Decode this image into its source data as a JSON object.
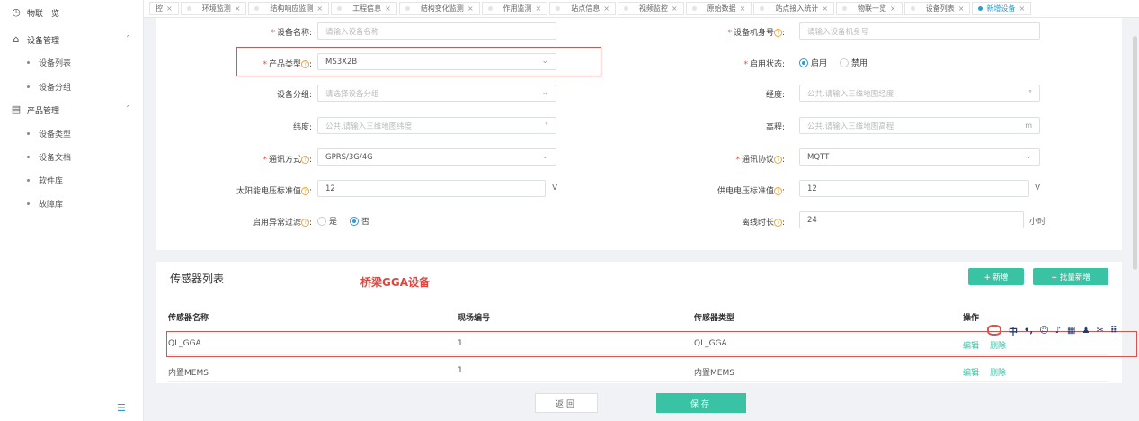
{
  "sidebar": {
    "top_item": "物联一览",
    "groups": [
      {
        "label": "设备管理",
        "items": [
          "设备列表",
          "设备分组"
        ]
      },
      {
        "label": "产品管理",
        "items": [
          "设备类型",
          "设备文档",
          "软件库",
          "故障库"
        ]
      }
    ]
  },
  "tabs": [
    "控",
    "环境监测",
    "结构响应监测",
    "工程信息",
    "结构变化监测",
    "作用监测",
    "站点信息",
    "视频监控",
    "原始数据",
    "站点接入统计",
    "物联一览",
    "设备列表",
    "新增设备"
  ],
  "form": {
    "device_name": {
      "label": "设备名称",
      "placeholder": "请输入设备名称"
    },
    "device_serial": {
      "label": "设备机身号",
      "placeholder": "请输入设备机身号"
    },
    "product_type": {
      "label": "产品类型",
      "value": "MS3X2B"
    },
    "enable_status": {
      "label": "启用状态",
      "options": [
        "启用",
        "禁用"
      ]
    },
    "device_group": {
      "label": "设备分组",
      "placeholder": "请选择设备分组"
    },
    "longitude": {
      "label": "经度",
      "placeholder": "公共.请输入三维地图经度",
      "suffix": "°"
    },
    "latitude": {
      "label": "纬度",
      "placeholder": "公共.请输入三维地图纬度",
      "suffix": "°"
    },
    "elevation": {
      "label": "高程",
      "placeholder": "公共.请输入三维地图高程",
      "suffix": "m"
    },
    "comm_mode": {
      "label": "通讯方式",
      "value": "GPRS/3G/4G"
    },
    "comm_protocol": {
      "label": "通讯协议",
      "value": "MQTT"
    },
    "solar_voltage": {
      "label": "太阳能电压标准值",
      "value": "12",
      "unit": "V"
    },
    "supply_voltage": {
      "label": "供电电压标准值",
      "value": "12",
      "unit": "V"
    },
    "anomaly_filter": {
      "label": "启用异常过滤",
      "options": [
        "是",
        "否"
      ]
    },
    "offline_duration": {
      "label": "离线时长",
      "value": "24",
      "unit": "小时"
    }
  },
  "sensors": {
    "title": "传感器列表",
    "annotation": "桥梁GGA设备",
    "add_label": "+ 新增",
    "batch_add_label": "+ 批量新增",
    "columns": [
      "传感器名称",
      "现场编号",
      "传感器类型",
      "操作"
    ],
    "rows": [
      {
        "name": "QL_GGA",
        "code": "1",
        "type": "QL_GGA"
      },
      {
        "name": "内置MEMS",
        "code": "1",
        "type": "内置MEMS"
      }
    ],
    "edit_label": "编辑",
    "delete_label": "删除"
  },
  "ime": [
    "中",
    "•,",
    "☺",
    "♪",
    "▦",
    "♟",
    "✂",
    "⠿"
  ],
  "actions": {
    "back": "返回",
    "save": "保存"
  },
  "colors": {
    "accent": "#2b9bd1",
    "primary_button": "#3ac2a4",
    "annotation": "#e0443d",
    "required": "#e74c3c",
    "help_icon": "#f5a623"
  }
}
